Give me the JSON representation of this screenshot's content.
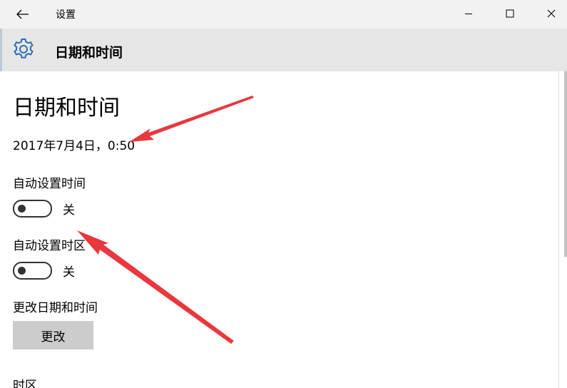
{
  "window": {
    "title": "设置",
    "back_icon": "back-arrow-icon",
    "minimize_icon": "minimize-icon",
    "maximize_icon": "maximize-icon",
    "close_icon": "close-icon"
  },
  "header": {
    "icon": "gear-icon",
    "title": "日期和时间"
  },
  "page": {
    "title": "日期和时间",
    "current_datetime": "2017年7月4日，0:50"
  },
  "settings": {
    "auto_time": {
      "label": "自动设置时间",
      "state": "关"
    },
    "auto_timezone": {
      "label": "自动设置时区",
      "state": "关"
    },
    "change_datetime": {
      "label": "更改日期和时间",
      "button_label": "更改"
    },
    "timezone": {
      "label": "时区"
    }
  },
  "colors": {
    "annotation_arrow": "#e8383d",
    "header_bg": "#e6e6e6",
    "gear_blue": "#2f6db5",
    "button_bg": "#cccccc"
  }
}
